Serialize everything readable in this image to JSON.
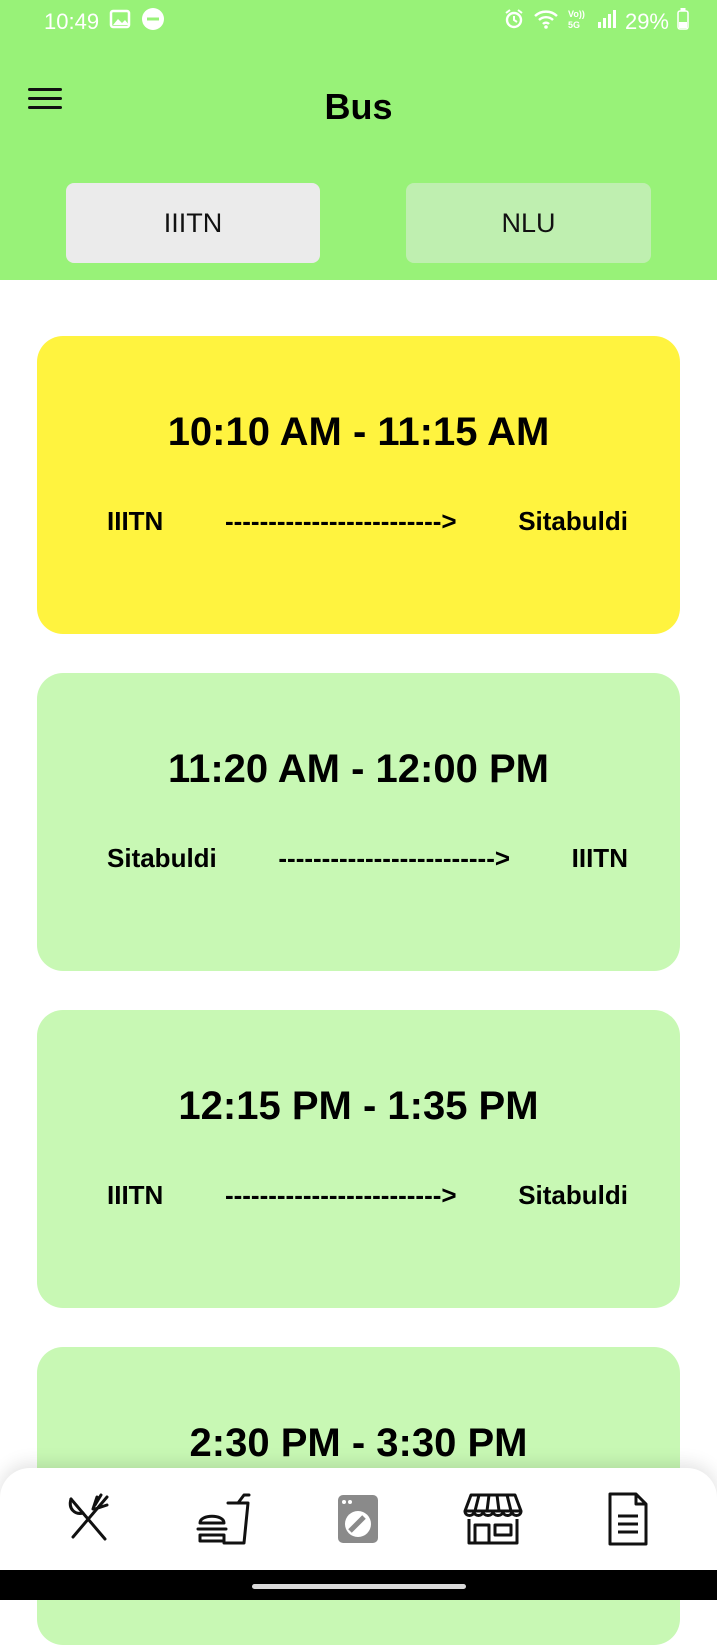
{
  "status_bar": {
    "time": "10:49",
    "battery": "29%"
  },
  "header": {
    "title": "Bus",
    "menu_icon": "hamburger-icon"
  },
  "tabs": [
    {
      "label": "IIITN",
      "selected": true
    },
    {
      "label": "NLU",
      "selected": false
    }
  ],
  "schedule": [
    {
      "time": "10:10 AM - 11:15 AM",
      "from": "IIITN",
      "arrow": "------------------------->",
      "to": "Sitabuldi",
      "highlight": true
    },
    {
      "time": "11:20 AM - 12:00 PM",
      "from": "Sitabuldi",
      "arrow": "------------------------->",
      "to": "IIITN",
      "highlight": false
    },
    {
      "time": "12:15 PM - 1:35 PM",
      "from": "IIITN",
      "arrow": "------------------------->",
      "to": "Sitabuldi",
      "highlight": false
    },
    {
      "time": "2:30 PM - 3:30 PM",
      "from": "",
      "arrow": "",
      "to": "",
      "highlight": false
    }
  ],
  "bottom_nav": [
    {
      "icon": "fork-knife-icon"
    },
    {
      "icon": "fast-food-icon"
    },
    {
      "icon": "laundry-icon"
    },
    {
      "icon": "store-icon"
    },
    {
      "icon": "document-icon"
    }
  ],
  "colors": {
    "accent_green": "#98f278",
    "card_green": "#c8f8b4",
    "card_highlight": "#fff33f",
    "tab_selected": "#ebebeb",
    "tab_unselected": "#bfefb0"
  }
}
